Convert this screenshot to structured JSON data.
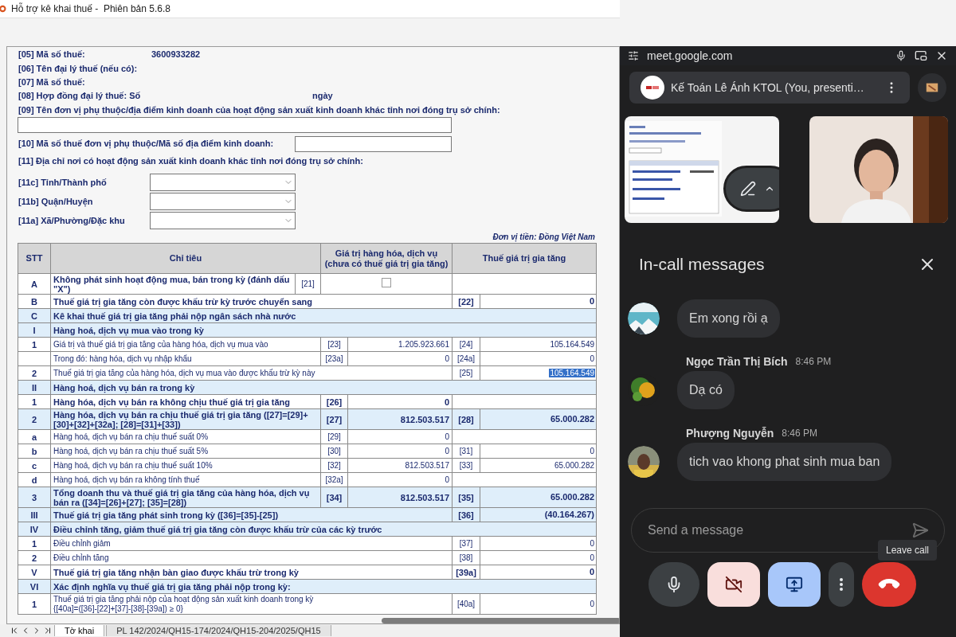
{
  "window": {
    "title": "Hỗ trợ kê khai thuế -  Phiên bản 5.6.8"
  },
  "form": {
    "fields": [
      {
        "kind": "text",
        "label": "[05] Mã số thuế:",
        "value": "3600933282"
      },
      {
        "kind": "text",
        "label": "[06] Tên đại lý thuế (nếu có):"
      },
      {
        "kind": "text",
        "label": "[07] Mã số thuế:"
      },
      {
        "kind": "contract",
        "label": "[08] Hợp đồng đại lý thuế: Số",
        "suffix": "ngày"
      },
      {
        "kind": "wide_input",
        "label": "[09] Tên đơn vị phụ thuộc/địa điểm kinh doanh của hoạt động sản xuất kinh doanh khác tỉnh nơi đóng trụ sở chính:"
      },
      {
        "kind": "inline_input",
        "label": "[10] Mã số thuế đơn vị phụ thuộc/Mã số địa điểm kinh doanh:"
      },
      {
        "kind": "heading",
        "label": "[11] Địa chỉ nơi có hoạt động sản xuất kinh doanh khác tỉnh nơi đóng trụ sở chính:"
      },
      {
        "kind": "combo",
        "label": "[11c] Tỉnh/Thành phố"
      },
      {
        "kind": "combo",
        "label": "[11b] Quận/Huyện"
      },
      {
        "kind": "combo",
        "label": "[11a] Xã/Phường/Đặc khu"
      }
    ],
    "currency_note": "Đơn vị tiền: Đồng Việt Nam"
  },
  "table": {
    "columns": [
      "STT",
      "Chỉ tiêu",
      "Giá trị hàng hóa, dịch vụ\n(chưa có thuế giá trị gia tăng)",
      "Thuế giá trị gia tăng"
    ],
    "rows": [
      {
        "kind": "checkbox",
        "stt": "A",
        "label": "Không phát sinh hoạt động mua, bán trong kỳ (đánh dấu \"X\")",
        "code": "[21]",
        "checked": false
      },
      {
        "kind": "line",
        "stt": "B",
        "label": "Thuế giá trị gia tăng còn được khấu trừ kỳ trước chuyển sang",
        "bold": true,
        "highlight": false,
        "tax_code": "[22]",
        "tax_value": "0",
        "selected": false
      },
      {
        "kind": "section",
        "stt": "C",
        "label": "Kê khai thuế giá trị gia tăng phải nộp ngân sách nhà nước"
      },
      {
        "kind": "section",
        "stt": "I",
        "label": "Hàng hoá, dịch vụ mua vào trong kỳ"
      },
      {
        "kind": "line",
        "stt": "1",
        "label": "Giá trị và thuế giá trị gia tăng của hàng hóa, dịch vụ mua vào",
        "bold": false,
        "highlight": false,
        "goods_code": "[23]",
        "goods_value": "1.205.923.661",
        "tax_code": "[24]",
        "tax_value": "105.164.549",
        "selected": false
      },
      {
        "kind": "line",
        "label": "Trong đó: hàng hóa, dịch vụ nhập khẩu",
        "bold": false,
        "highlight": false,
        "goods_code": "[23a]",
        "goods_value": "0",
        "tax_code": "[24a]",
        "tax_value": "0",
        "selected": false
      },
      {
        "kind": "line",
        "stt": "2",
        "label": "Thuế giá trị gia tăng của hàng hóa, dịch vụ mua vào được khấu trừ kỳ này",
        "bold": false,
        "highlight": false,
        "tax_code": "[25]",
        "tax_value": "105.164.549",
        "selected": true
      },
      {
        "kind": "section",
        "stt": "II",
        "label": "Hàng hoá, dịch vụ bán ra trong kỳ"
      },
      {
        "kind": "line",
        "stt": "1",
        "label": "Hàng hóa, dịch vụ bán ra không chịu thuế giá trị gia tăng",
        "bold": true,
        "highlight": false,
        "goods_code": "[26]",
        "goods_value": "0"
      },
      {
        "kind": "line",
        "stt": "2",
        "label": "Hàng hóa, dịch vụ bán ra chịu thuế giá trị gia tăng ([27]=[29]+[30]+[32]+[32a]; [28]=[31]+[33])",
        "bold": true,
        "highlight": true,
        "goods_code": "[27]",
        "goods_value": "812.503.517",
        "tax_code": "[28]",
        "tax_value": "65.000.282",
        "selected": false
      },
      {
        "kind": "line",
        "stt": "a",
        "label": "Hàng hoá, dịch vụ bán ra chịu thuế suất 0%",
        "bold": false,
        "highlight": false,
        "goods_code": "[29]",
        "goods_value": "0"
      },
      {
        "kind": "line",
        "stt": "b",
        "label": "Hàng hoá, dịch vụ bán ra chịu thuế suất 5%",
        "bold": false,
        "highlight": false,
        "goods_code": "[30]",
        "goods_value": "0",
        "tax_code": "[31]",
        "tax_value": "0",
        "selected": false
      },
      {
        "kind": "line",
        "stt": "c",
        "label": "Hàng hoá, dịch vụ bán ra chịu thuế suất 10%",
        "bold": false,
        "highlight": false,
        "goods_code": "[32]",
        "goods_value": "812.503.517",
        "tax_code": "[33]",
        "tax_value": "65.000.282",
        "selected": false
      },
      {
        "kind": "line",
        "stt": "d",
        "label": "Hàng hoá, dịch vụ bán ra không tính thuế",
        "bold": false,
        "highlight": false,
        "goods_code": "[32a]",
        "goods_value": "0"
      },
      {
        "kind": "line",
        "stt": "3",
        "label": "Tổng doanh thu và thuế giá trị gia tăng của hàng hóa, dịch vụ bán ra ([34]=[26]+[27]; [35]=[28])",
        "bold": true,
        "highlight": true,
        "goods_code": "[34]",
        "goods_value": "812.503.517",
        "tax_code": "[35]",
        "tax_value": "65.000.282",
        "selected": false
      },
      {
        "kind": "line",
        "stt": "III",
        "label": "Thuế giá trị gia tăng phát sinh trong kỳ ([36]=[35]-[25])",
        "bold": true,
        "highlight": true,
        "tax_code": "[36]",
        "tax_value": "(40.164.267)",
        "selected": false
      },
      {
        "kind": "section",
        "stt": "IV",
        "label": "Điều chỉnh tăng, giảm thuế giá trị gia tăng còn được khấu trừ của các kỳ trước"
      },
      {
        "kind": "line",
        "stt": "1",
        "label": "Điều chỉnh giảm",
        "bold": false,
        "highlight": false,
        "tax_code": "[37]",
        "tax_value": "0",
        "selected": false
      },
      {
        "kind": "line",
        "stt": "2",
        "label": "Điều chỉnh tăng",
        "bold": false,
        "highlight": false,
        "tax_code": "[38]",
        "tax_value": "0",
        "selected": false
      },
      {
        "kind": "line",
        "stt": "V",
        "label": "Thuế giá trị gia tăng nhận bàn giao được khấu trừ trong kỳ",
        "bold": true,
        "highlight": false,
        "tax_code": "[39a]",
        "tax_value": "0",
        "selected": false
      },
      {
        "kind": "section",
        "stt": "VI",
        "label": "Xác định nghĩa vụ thuế giá trị gia tăng phải nộp trong kỳ:"
      },
      {
        "kind": "line",
        "stt": "1",
        "label": "Thuế giá trị gia tăng phải nộp của hoạt động sản xuất kinh doanh trong kỳ\n{[40a]=([36]-[22]+[37]-[38]-[39a]) ≥ 0}",
        "bold": false,
        "highlight": false,
        "tax_code": "[40a]",
        "tax_value": "0",
        "selected": false
      }
    ]
  },
  "sheet_tabs": [
    {
      "label": "Tờ khai",
      "selected": true
    },
    {
      "label": "PL 142/2024/QH15-174/2024/QH15-204/2025/QH15",
      "selected": false
    }
  ],
  "meet": {
    "url": "meet.google.com",
    "presenter": "Kế Toán Lê Ánh KTOL (You, presenti…",
    "messages_title": "In-call messages",
    "messages": [
      {
        "text": "Em xong rồi ạ"
      },
      {
        "sender": "Ngọc Trần Thị Bích",
        "time": "8:46 PM",
        "text": "Dạ có"
      },
      {
        "sender": "Phượng Nguyễn",
        "time": "8:46 PM",
        "text": "tich vao khong phat sinh mua ban"
      }
    ],
    "composer": {
      "placeholder": "Send a message"
    },
    "tooltip": "Leave call",
    "controls": [
      {
        "kind": "mic",
        "on": true
      },
      {
        "kind": "camera",
        "on": false
      },
      {
        "kind": "present",
        "on": true
      },
      {
        "kind": "more"
      },
      {
        "kind": "leave"
      }
    ]
  }
}
